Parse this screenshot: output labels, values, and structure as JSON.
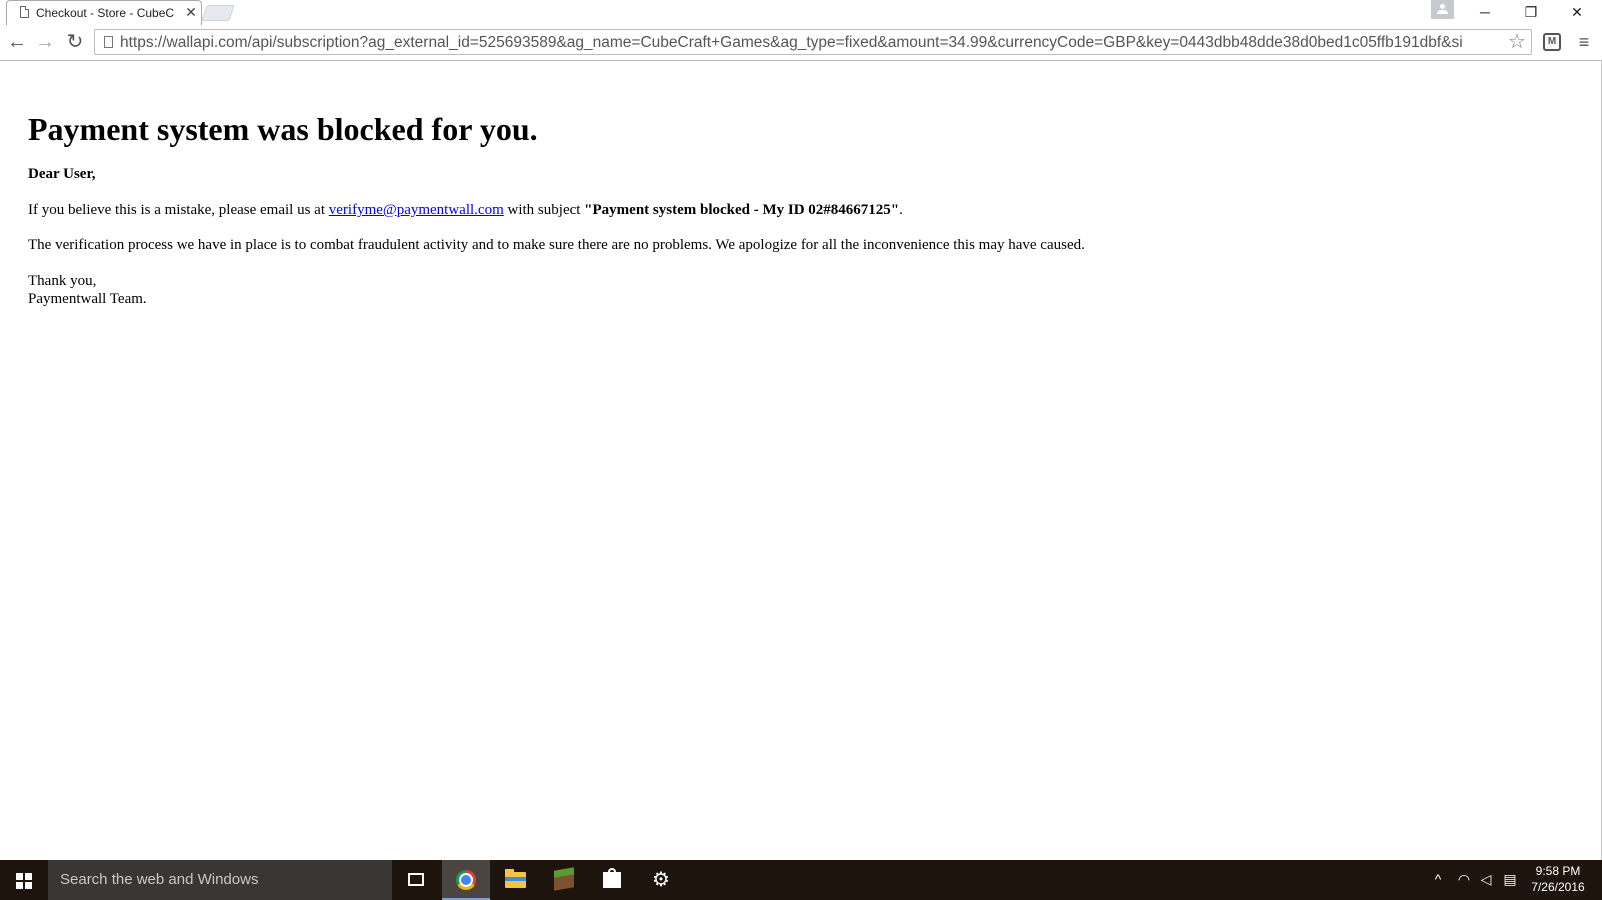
{
  "browser": {
    "tab": {
      "title": "Checkout - Store - CubeC",
      "close_glyph": "✕"
    },
    "window_controls": {
      "minimize": "─",
      "restore": "❐",
      "close": "✕"
    },
    "toolbar": {
      "back_glyph": "←",
      "forward_glyph": "→",
      "reload_glyph": "↻",
      "url": "https://wallapi.com/api/subscription?ag_external_id=525693589&ag_name=CubeCraft+Games&ag_type=fixed&amount=34.99&currencyCode=GBP&key=0443dbb48dde38d0bed1c05ffb191dbf&si",
      "star_glyph": "☆",
      "menu_glyph": "≡"
    }
  },
  "page": {
    "heading": "Payment system was blocked for you.",
    "greeting": "Dear User,",
    "line1_prefix": "If you believe this is a mistake, please email us at ",
    "email": "verifyme@paymentwall.com",
    "line1_middle": " with subject ",
    "subject": "\"Payment system blocked - My ID 02#84667125\"",
    "line1_suffix": ".",
    "line2": "The verification process we have in place is to combat fraudulent activity and to make sure there are no problems. We apologize for all the inconvenience this may have caused.",
    "closing1": "Thank you,",
    "closing2": "Paymentwall Team."
  },
  "taskbar": {
    "search_placeholder": "Search the web and Windows",
    "apps": [
      "task-view",
      "chrome",
      "file-explorer",
      "minecraft",
      "store",
      "steam"
    ],
    "tray_icons": [
      "chevron-up-icon",
      "wifi-icon",
      "volume-icon",
      "notifications-icon"
    ],
    "time": "9:58 PM",
    "date": "7/26/2016"
  },
  "colors": {
    "link": "#0000ee",
    "taskbar": "#1d140e",
    "search_box": "#3a3633"
  }
}
